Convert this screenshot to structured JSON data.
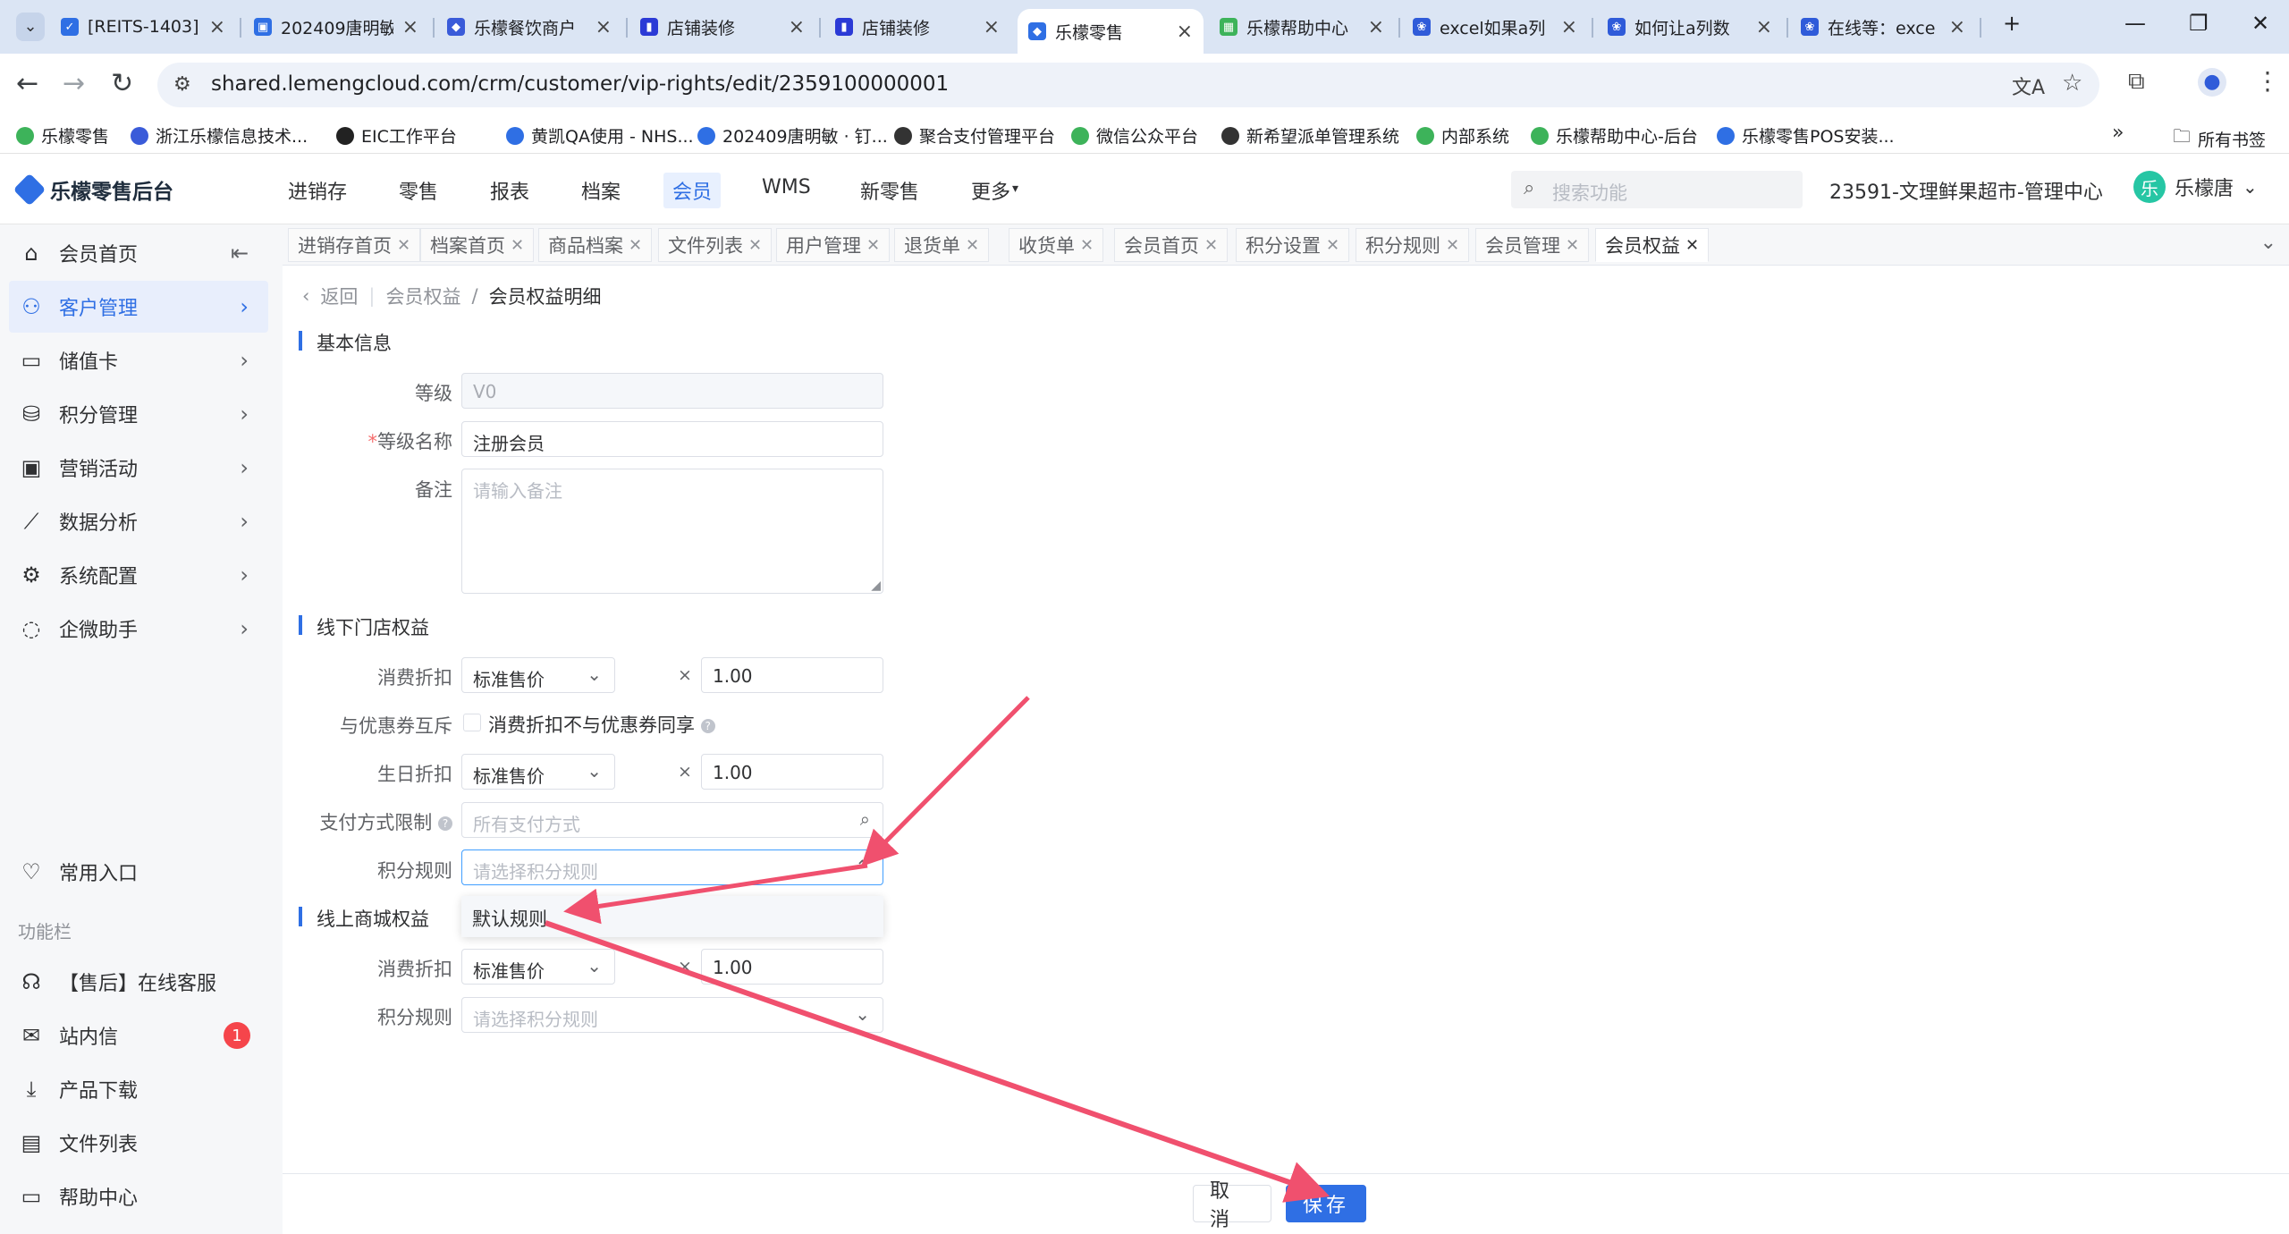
{
  "browser": {
    "tabs": [
      {
        "title": "[REITS-1403]",
        "fav_color": "#2f6fe4",
        "fav_glyph": "✓"
      },
      {
        "title": "202409唐明敏",
        "fav_color": "#2f6fe4",
        "fav_glyph": "▣"
      },
      {
        "title": "乐檬餐饮商户",
        "fav_color": "#3a5bd9",
        "fav_glyph": "◆"
      },
      {
        "title": "店铺装修",
        "fav_color": "#2b3ad6",
        "fav_glyph": "▮"
      },
      {
        "title": "店铺装修",
        "fav_color": "#2b3ad6",
        "fav_glyph": "▮"
      },
      {
        "title": "乐檬零售",
        "fav_color": "#2f6fe4",
        "fav_glyph": "◆"
      },
      {
        "title": "乐檬帮助中心",
        "fav_color": "#3db35a",
        "fav_glyph": "▦"
      },
      {
        "title": "excel如果a列",
        "fav_color": "#2f5bd9",
        "fav_glyph": "❀"
      },
      {
        "title": "如何让a列数",
        "fav_color": "#2f5bd9",
        "fav_glyph": "❀"
      },
      {
        "title": "在线等：exce",
        "fav_color": "#2f5bd9",
        "fav_glyph": "❀"
      }
    ],
    "url": "shared.lemengcloud.com/crm/customer/vip-rights/edit/2359100000001",
    "bookmarks": [
      {
        "label": "乐檬零售",
        "color": "#3db35a"
      },
      {
        "label": "浙江乐檬信息技术...",
        "color": "#3a5bd9"
      },
      {
        "label": "EIC工作平台",
        "color": "#222222"
      },
      {
        "label": "黄凯QA使用 - NHS...",
        "color": "#2f6fe4"
      },
      {
        "label": "202409唐明敏 · 钉...",
        "color": "#2f6fe4"
      },
      {
        "label": "聚合支付管理平台",
        "color": "#333333"
      },
      {
        "label": "微信公众平台",
        "color": "#3db35a"
      },
      {
        "label": "新希望派单管理系统",
        "color": "#333333"
      },
      {
        "label": "内部系统",
        "color": "#3db35a"
      },
      {
        "label": "乐檬帮助中心-后台",
        "color": "#3db35a"
      },
      {
        "label": "乐檬零售POS安装...",
        "color": "#2f6fe4"
      }
    ],
    "all_bookmarks": "所有书签"
  },
  "app": {
    "logo_text": "乐檬零售后台",
    "menu": [
      "进销存",
      "零售",
      "报表",
      "档案",
      "会员",
      "WMS",
      "新零售",
      "更多"
    ],
    "active_menu": "会员",
    "search_placeholder": "搜索功能",
    "org": "23591-文理鲜果超市-管理中心",
    "user_initial": "乐",
    "user_name": "乐檬唐",
    "accent": "#2f6fe4"
  },
  "sidebar": {
    "items": [
      {
        "label": "会员首页",
        "icon": "home-icon"
      },
      {
        "label": "客户管理",
        "icon": "user-icon"
      },
      {
        "label": "储值卡",
        "icon": "card-icon"
      },
      {
        "label": "积分管理",
        "icon": "database-icon"
      },
      {
        "label": "营销活动",
        "icon": "monitor-icon"
      },
      {
        "label": "数据分析",
        "icon": "chart-icon"
      },
      {
        "label": "系统配置",
        "icon": "settings-icon"
      },
      {
        "label": "企微助手",
        "icon": "chat-icon"
      }
    ],
    "favorites": "常用入口",
    "toolbar_title": "功能栏",
    "tools": [
      {
        "label": "【售后】在线客服",
        "icon": "headset-icon"
      },
      {
        "label": "站内信",
        "icon": "mail-icon",
        "badge": "1"
      },
      {
        "label": "产品下载",
        "icon": "download-icon"
      },
      {
        "label": "文件列表",
        "icon": "file-list-icon"
      },
      {
        "label": "帮助中心",
        "icon": "help-icon"
      }
    ]
  },
  "content_tabs": [
    "进销存首页",
    "档案首页",
    "商品档案",
    "文件列表",
    "用户管理",
    "退货单",
    "收货单",
    "会员首页",
    "积分设置",
    "积分规则",
    "会员管理",
    "会员权益"
  ],
  "breadcrumb": {
    "back": "返回",
    "parent": "会员权益",
    "current": "会员权益明细"
  },
  "form": {
    "basic_title": "基本信息",
    "level_label": "等级",
    "level_value": "V0",
    "name_label": "等级名称",
    "name_value": "注册会员",
    "remark_label": "备注",
    "remark_placeholder": "请输入备注",
    "offline_title": "线下门店权益",
    "discount_label": "消费折扣",
    "discount_select": "标准售价",
    "discount_rate": "1.00",
    "coupon_label": "与优惠券互斥",
    "coupon_checkbox": "消费折扣不与优惠券同享",
    "birthday_label": "生日折扣",
    "birthday_select": "标准售价",
    "birthday_rate": "1.00",
    "payment_label": "支付方式限制",
    "payment_placeholder": "所有支付方式",
    "points_label": "积分规则",
    "points_placeholder": "请选择积分规则",
    "dropdown_option": "默认规则",
    "online_title": "线上商城权益",
    "online_discount_label": "消费折扣",
    "online_discount_select": "标准售价",
    "online_discount_rate": "1.00",
    "online_points_label": "积分规则",
    "online_points_placeholder": "请选择积分规则",
    "times_sign": "×"
  },
  "footer": {
    "cancel": "取消",
    "save": "保存"
  },
  "annotation_color": "#f0506e"
}
